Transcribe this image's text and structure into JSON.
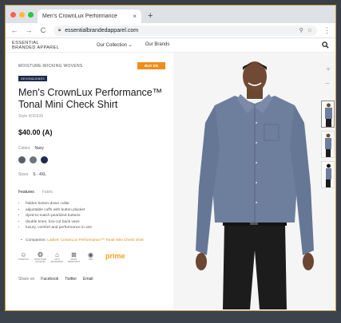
{
  "browser": {
    "tab_title": "Men's CrownLux Performance",
    "tab_close": "×",
    "new_tab": "+",
    "url": "essentialbrandedapparel.com",
    "back": "←",
    "forward": "→",
    "reload": "C",
    "menu": "⋮"
  },
  "site": {
    "logo_line1": "ESSENTIAL",
    "logo_line2": "BRANDED APPAREL",
    "nav": [
      "Our Collection ⌄",
      "Our Brands"
    ]
  },
  "product": {
    "category": "MOISTURE-WICKING WOVENS",
    "badge": "BUY EB",
    "brand_tag": "DEVON&JONES",
    "title_line1": "Men's CrownLux Performance™",
    "title_line2": "Tonal Mini Check Shirt",
    "style": "Style #DG535",
    "price": "$40.00 (A)",
    "colors_label": "Colors",
    "colors_value": "Navy",
    "swatches": [
      "#5b6068",
      "#6f747a",
      "#1e2b4a"
    ],
    "sizes_label": "Sizes",
    "sizes_value": "S - 4XL",
    "tabs": [
      "Features",
      "Fabric"
    ],
    "features": [
      "hidden button-down collar",
      "adjustable cuffs with button placket",
      "dyed-to-match pearlized buttons",
      "double knee, box-cut back vees",
      "luxury, comfort and performance in one"
    ],
    "companion_prefix": "Companion:",
    "companion_link": "Ladies' CrownLux Performance™ Tonal Mini Check Shirt",
    "care": [
      {
        "icon": "☺",
        "label": "STRETCH"
      },
      {
        "icon": "❂",
        "label": "MOISTURE WICKING"
      },
      {
        "icon": "⌂",
        "label": "ANTI MICROBIAL"
      },
      {
        "icon": "⊠",
        "label": "SNAG RESISTANT"
      },
      {
        "icon": "◉",
        "label": "UPF"
      }
    ],
    "prime": "prime",
    "share_label": "Share on",
    "share": [
      "Facebook",
      "Twitter",
      "Email"
    ]
  },
  "gallery": {
    "zoom_in": "+",
    "zoom_out": "−"
  },
  "colors": {
    "accent": "#f08c1e",
    "shirt": "#6e7f9e",
    "pants": "#1c1c1c"
  }
}
